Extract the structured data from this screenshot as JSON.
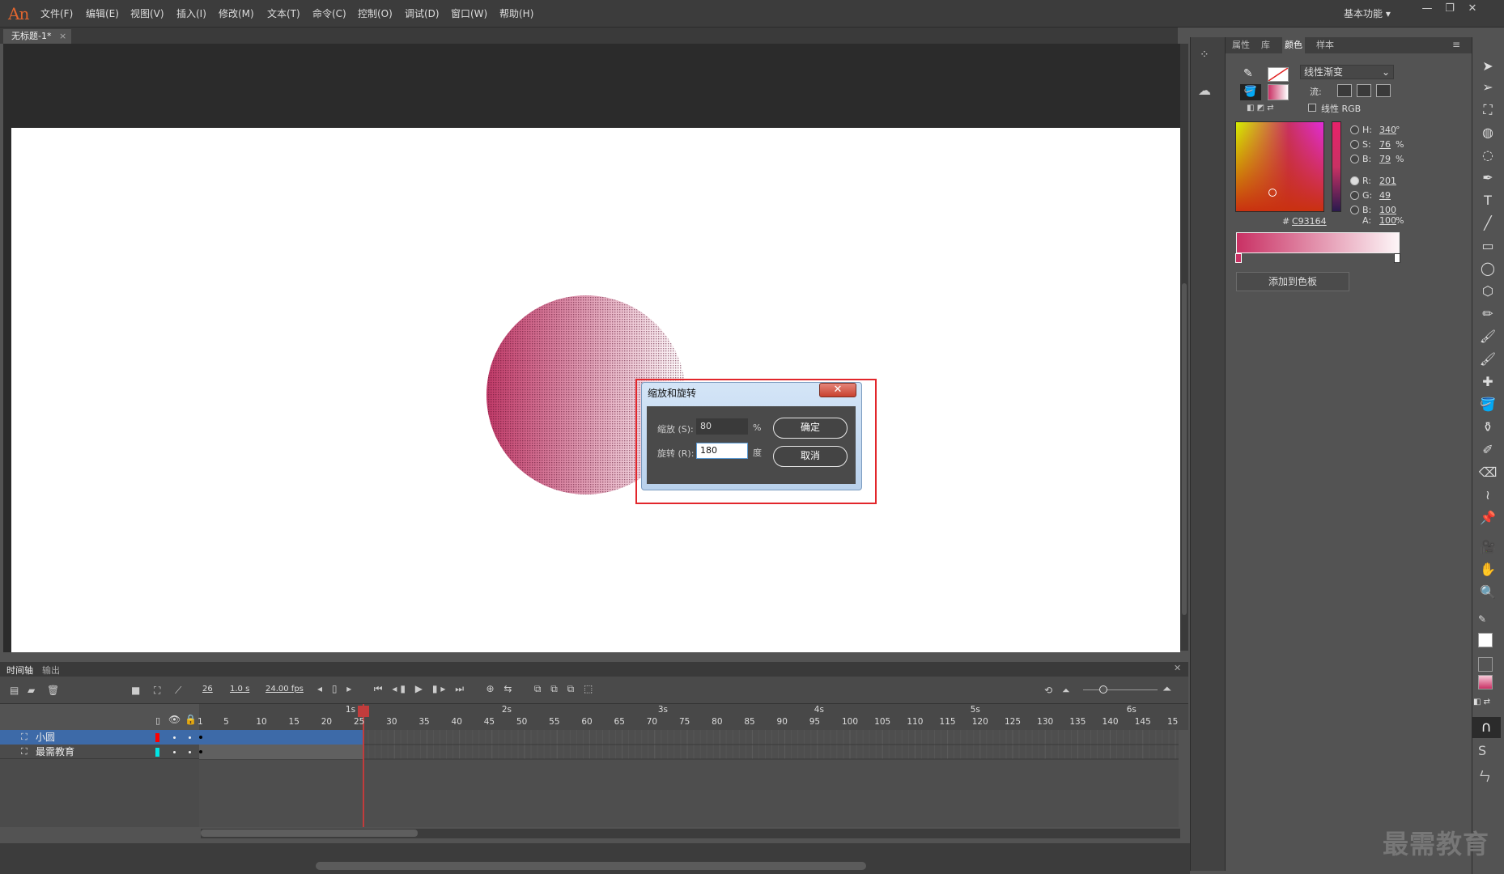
{
  "app": {
    "logo": "An"
  },
  "menu": [
    "文件(F)",
    "编辑(E)",
    "视图(V)",
    "插入(I)",
    "修改(M)",
    "文本(T)",
    "命令(C)",
    "控制(O)",
    "调试(D)",
    "窗口(W)",
    "帮助(H)"
  ],
  "workspace": {
    "label": "基本功能"
  },
  "window_controls": [
    "—",
    "❐",
    "✕"
  ],
  "doc_tab": {
    "title": "无标题-1*",
    "close": "×"
  },
  "dialog": {
    "title": "缩放和旋转",
    "close": "✕",
    "scale_label": "缩放 (S):",
    "scale_value": "80",
    "scale_unit": "%",
    "rotate_label": "旋转 (R):",
    "rotate_value": "180",
    "rotate_unit": "度",
    "ok": "确定",
    "cancel": "取消"
  },
  "color_panel": {
    "tabs": [
      "属性",
      "库",
      "颜色",
      "样本"
    ],
    "active_tab": "颜色",
    "fill_type": "线性渐变",
    "flow_label": "流:",
    "linear_rgb_label": "线性 RGB",
    "H": {
      "label": "H:",
      "value": "340",
      "unit": "°"
    },
    "S": {
      "label": "S:",
      "value": "76",
      "unit": "%"
    },
    "Bv": {
      "label": "B:",
      "value": "79",
      "unit": "%"
    },
    "R": {
      "label": "R:",
      "value": "201"
    },
    "G": {
      "label": "G:",
      "value": "49"
    },
    "Bc": {
      "label": "B:",
      "value": "100"
    },
    "A": {
      "label": "A:",
      "value": "100",
      "unit": "%"
    },
    "hex_label": "#",
    "hex": "C93164",
    "add_swatch": "添加到色板",
    "gradient_color": "#c93164"
  },
  "timeline": {
    "tabs": [
      "时间轴",
      "输出"
    ],
    "frame": "26",
    "time": "1.0 s",
    "fps": "24.00 fps",
    "seconds": [
      "1s",
      "2s",
      "3s",
      "4s",
      "5s",
      "6s"
    ],
    "ticks": [
      "1",
      "5",
      "10",
      "15",
      "20",
      "25",
      "30",
      "35",
      "40",
      "45",
      "50",
      "55",
      "60",
      "65",
      "70",
      "75",
      "80",
      "85",
      "90",
      "95",
      "100",
      "105",
      "110",
      "115",
      "120",
      "125",
      "130",
      "135",
      "140",
      "145",
      "15"
    ],
    "layers": [
      {
        "name": "小圆",
        "color": "#ff0000",
        "selected": true
      },
      {
        "name": "最需教育",
        "color": "#00e5e5",
        "selected": false
      }
    ]
  },
  "watermark": "最需教育"
}
